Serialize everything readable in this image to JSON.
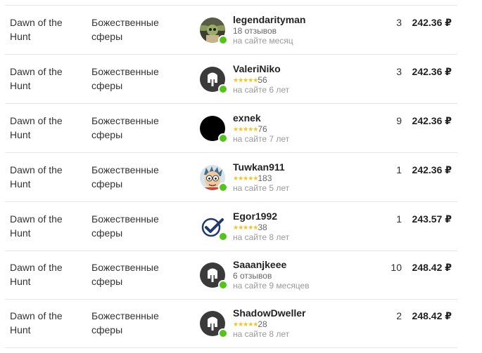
{
  "offers": [
    {
      "game": "Dawn of the Hunt",
      "category": "Божественные сферы",
      "seller": "legendarityman",
      "avatar": "grogu-photo-avatar",
      "has_stars": false,
      "reviews": "18 отзывов",
      "since": "на сайте месяц",
      "amount": "3",
      "price": "242.36 ₽",
      "online": true
    },
    {
      "game": "Dawn of the Hunt",
      "category": "Божественные сферы",
      "seller": "ValeriNiko",
      "avatar": "default-helmet-avatar",
      "has_stars": true,
      "stars": "★★★★★",
      "reviews": "56",
      "since": "на сайте 6 лет",
      "amount": "3",
      "price": "242.36 ₽",
      "online": true
    },
    {
      "game": "Dawn of the Hunt",
      "category": "Божественные сферы",
      "seller": "exnek",
      "avatar": "black-circle-avatar",
      "has_stars": true,
      "stars": "★★★★★",
      "reviews": "76",
      "since": "на сайте 7 лет",
      "amount": "9",
      "price": "242.36 ₽",
      "online": true
    },
    {
      "game": "Dawn of the Hunt",
      "category": "Божественные сферы",
      "seller": "Tuwkan911",
      "avatar": "cartoon-face-avatar",
      "has_stars": true,
      "stars": "★★★★★",
      "reviews": "183",
      "since": "на сайте 5 лет",
      "amount": "1",
      "price": "242.36 ₽",
      "online": true
    },
    {
      "game": "Dawn of the Hunt",
      "category": "Божественные сферы",
      "seller": "Egor1992",
      "avatar": "checkmark-avatar",
      "has_stars": true,
      "stars": "★★★★★",
      "reviews": "38",
      "since": "на сайте 8 лет",
      "amount": "1",
      "price": "243.57 ₽",
      "online": true
    },
    {
      "game": "Dawn of the Hunt",
      "category": "Божественные сферы",
      "seller": "Saaanjkeee",
      "avatar": "default-helmet-avatar",
      "has_stars": false,
      "reviews": "6 отзывов",
      "since": "на сайте 9 месяцев",
      "amount": "10",
      "price": "248.42 ₽",
      "online": true
    },
    {
      "game": "Dawn of the Hunt",
      "category": "Божественные сферы",
      "seller": "ShadowDweller",
      "avatar": "default-helmet-avatar",
      "has_stars": true,
      "stars": "★★★★★",
      "reviews": "28",
      "since": "на сайте 8 лет",
      "amount": "2",
      "price": "248.42 ₽",
      "online": true
    }
  ],
  "colors": {
    "star": "#f5c518",
    "online": "#52c41a",
    "divider": "#e6e6e6",
    "muted": "#999999",
    "checkmark": "#1f3a6e"
  }
}
